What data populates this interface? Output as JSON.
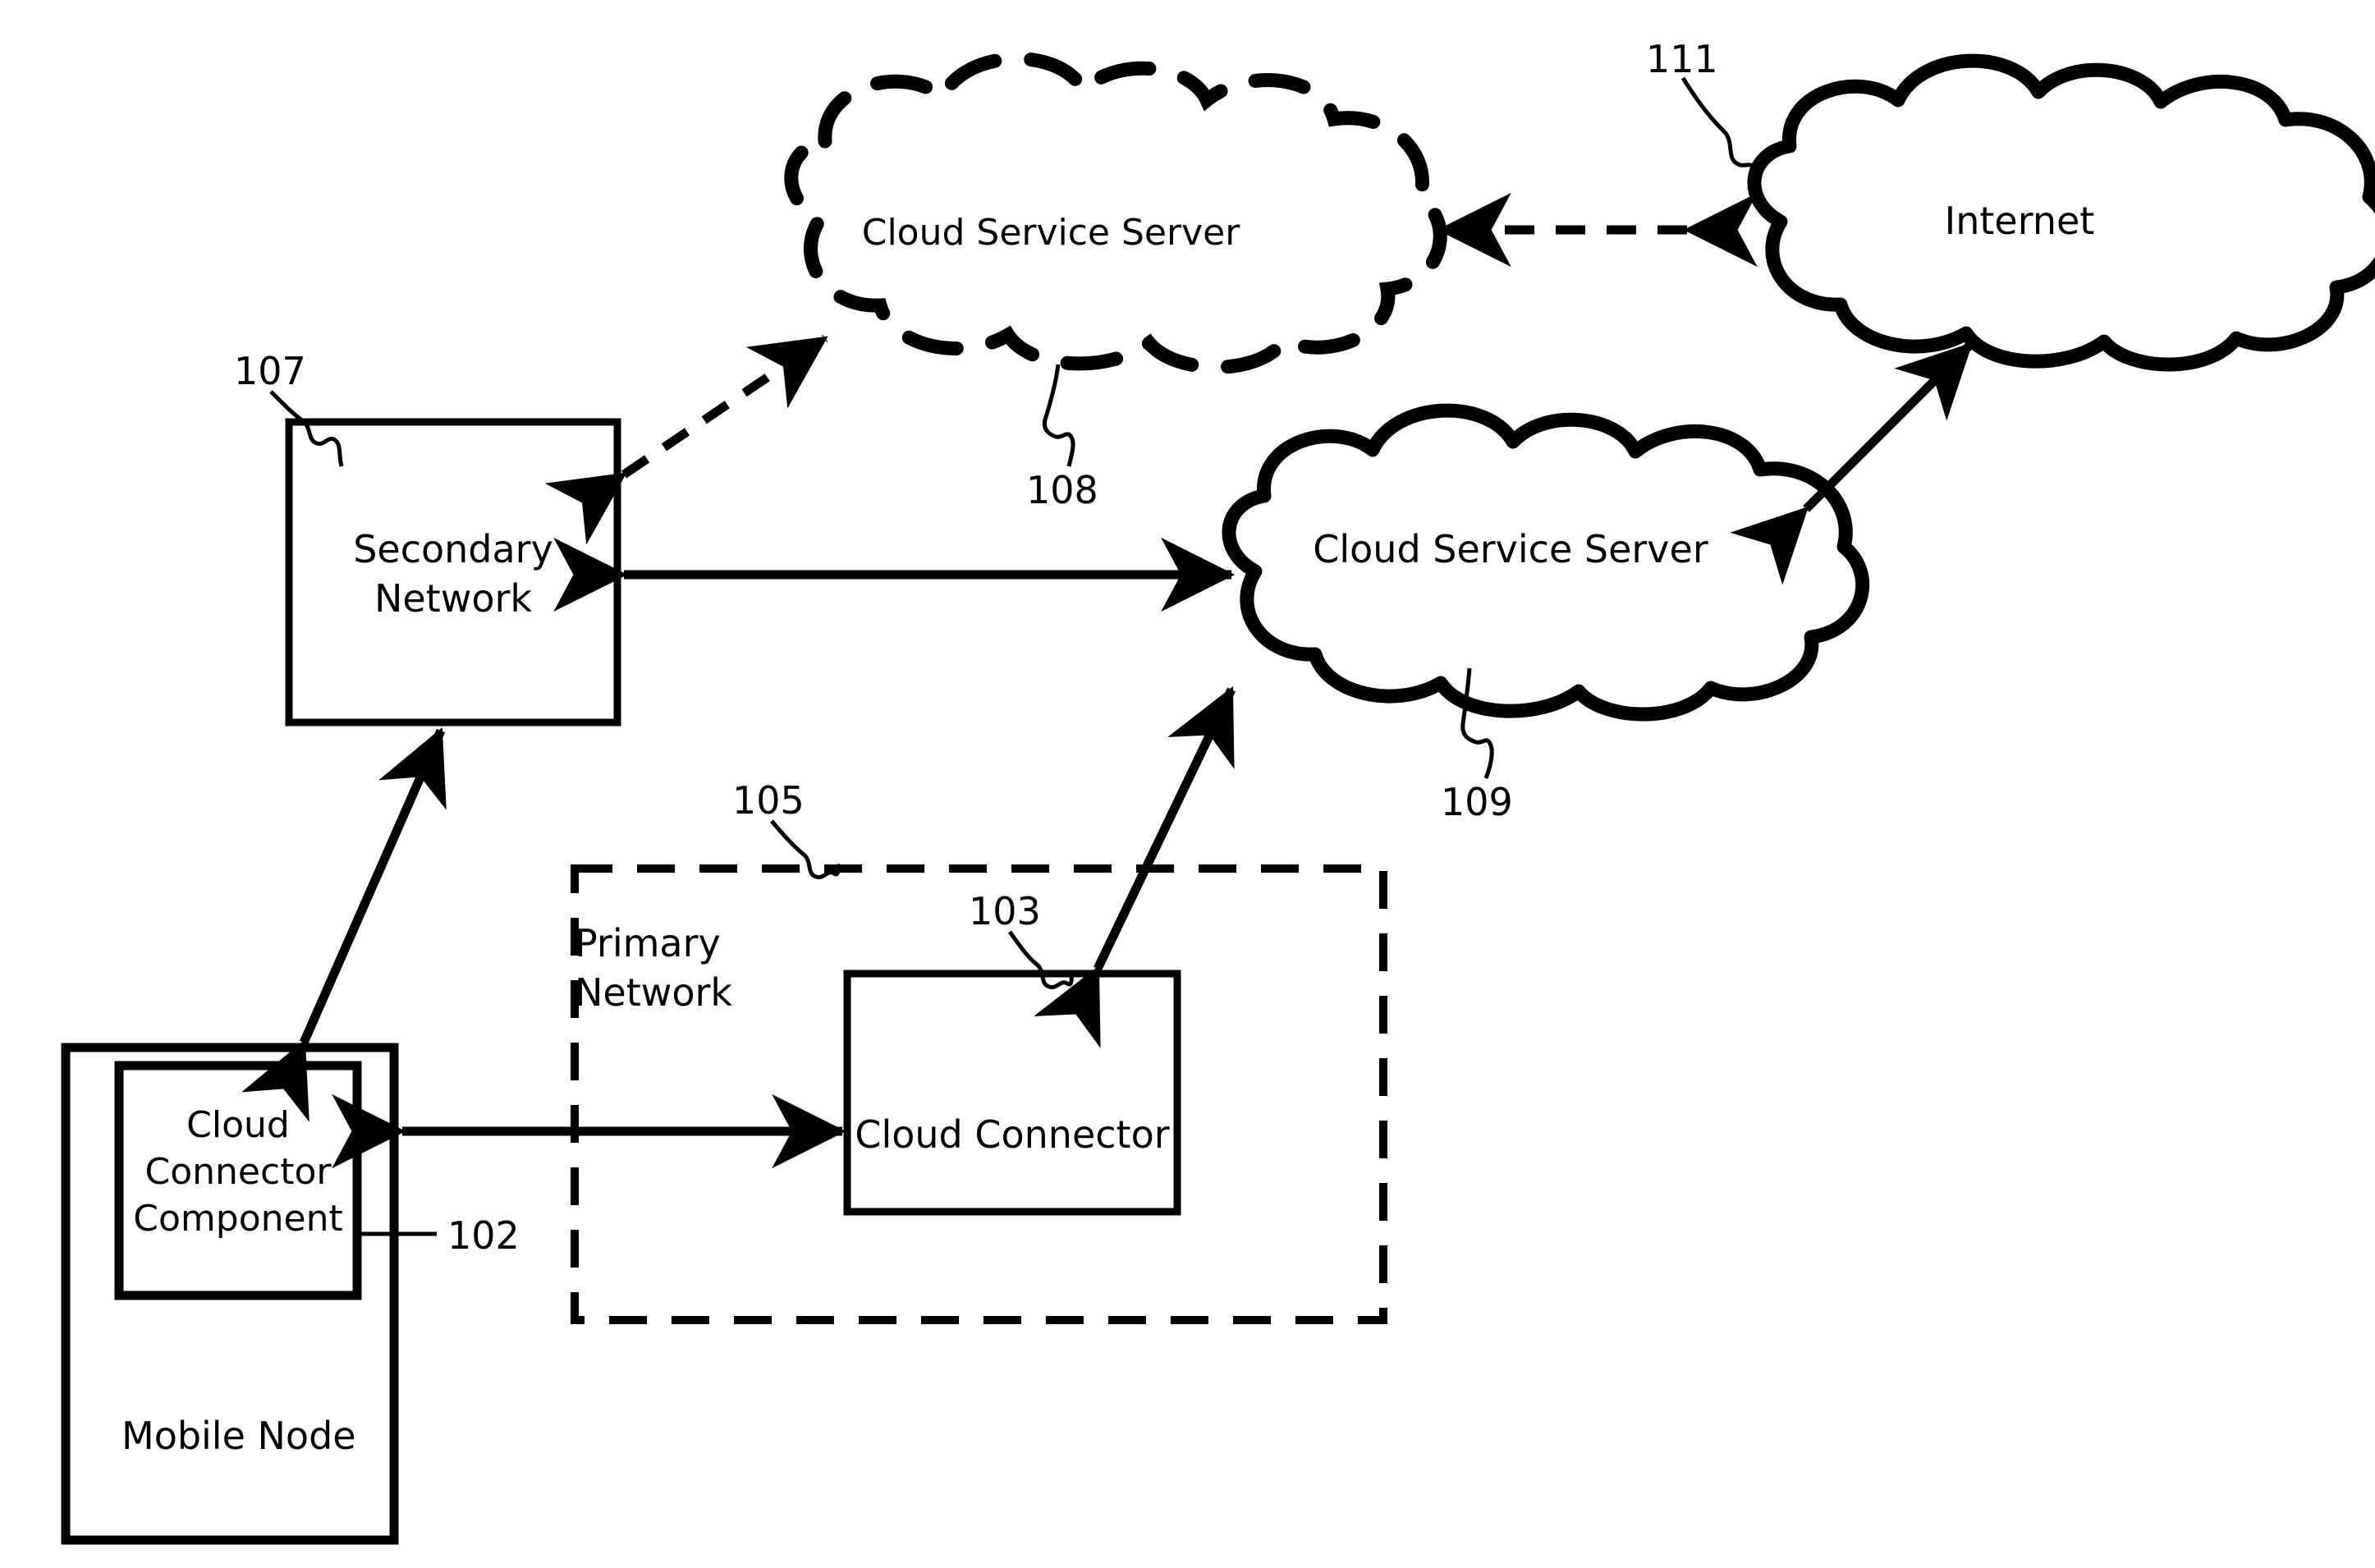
{
  "figure": {
    "type": "patent-network-architecture-diagram",
    "background_color": "#FFFFFF",
    "line_color": "#000000"
  },
  "nodes": {
    "cloud_service_server_dashed": {
      "label": "Cloud Service Server",
      "ref": "108",
      "shape": "cloud",
      "border_style": "dashed"
    },
    "internet": {
      "label": "Internet",
      "ref": "111",
      "shape": "cloud",
      "border_style": "solid"
    },
    "cloud_service_server_solid": {
      "label": "Cloud Service Server",
      "ref": "109",
      "shape": "cloud",
      "border_style": "solid"
    },
    "secondary_network": {
      "label": "Secondary\nNetwork",
      "ref": "107",
      "shape": "rectangle",
      "border_style": "solid"
    },
    "primary_network": {
      "label": "Primary\nNetwork",
      "ref": "105",
      "shape": "rectangle",
      "border_style": "dashed"
    },
    "cloud_connector": {
      "label": "Cloud Connector",
      "ref": "103",
      "shape": "rectangle",
      "border_style": "solid"
    },
    "mobile_node": {
      "label": "Mobile Node",
      "shape": "rectangle",
      "border_style": "solid"
    },
    "cloud_connector_component": {
      "label": "Cloud\nConnector\nComponent",
      "ref": "102",
      "shape": "rectangle",
      "border_style": "solid"
    }
  },
  "reference_numerals": {
    "n102": "102",
    "n103": "103",
    "n105": "105",
    "n107": "107",
    "n108": "108",
    "n109": "109",
    "n111": "111"
  },
  "connections": [
    {
      "from": "internet",
      "to": "cloud_service_server_dashed",
      "style": "dashed",
      "arrows": "both"
    },
    {
      "from": "secondary_network",
      "to": "cloud_service_server_dashed",
      "style": "dashed",
      "arrows": "both"
    },
    {
      "from": "secondary_network",
      "to": "cloud_service_server_solid",
      "style": "solid",
      "arrows": "both"
    },
    {
      "from": "cloud_service_server_solid",
      "to": "internet",
      "style": "solid",
      "arrows": "both"
    },
    {
      "from": "cloud_connector",
      "to": "cloud_service_server_solid",
      "style": "solid",
      "arrows": "both"
    },
    {
      "from": "mobile_node",
      "to": "secondary_network",
      "style": "solid",
      "arrows": "both"
    },
    {
      "from": "cloud_connector_component",
      "to": "cloud_connector",
      "style": "solid",
      "arrows": "both"
    }
  ]
}
